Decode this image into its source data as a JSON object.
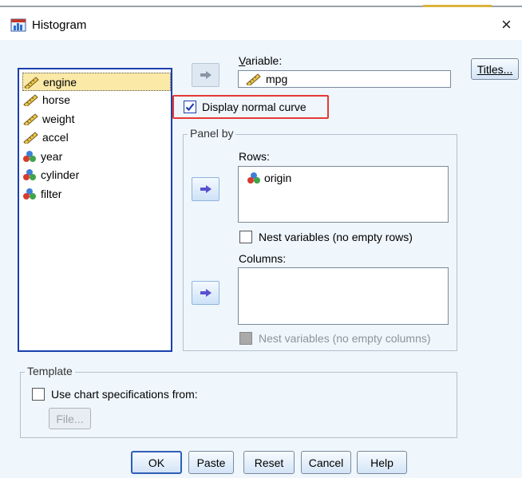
{
  "window": {
    "title": "Histogram",
    "close_glyph": "×"
  },
  "variables": {
    "items": [
      {
        "label": "engine",
        "icon": "ruler-scale-icon",
        "selected": true
      },
      {
        "label": "horse",
        "icon": "ruler-scale-icon",
        "selected": false
      },
      {
        "label": "weight",
        "icon": "ruler-scale-icon",
        "selected": false
      },
      {
        "label": "accel",
        "icon": "ruler-scale-icon",
        "selected": false
      },
      {
        "label": "year",
        "icon": "nominal-balls-icon",
        "selected": false
      },
      {
        "label": "cylinder",
        "icon": "nominal-balls-icon",
        "selected": false
      },
      {
        "label": "filter",
        "icon": "nominal-balls-icon",
        "selected": false
      }
    ]
  },
  "variable_field": {
    "label": "Variable:",
    "value": "mpg",
    "icon": "ruler-scale-icon"
  },
  "normal_curve": {
    "label": "Display normal curve",
    "checked": true
  },
  "panel_by": {
    "title": "Panel by",
    "rows": {
      "label": "Rows:",
      "values": [
        "origin"
      ],
      "icon": "nominal-balls-icon"
    },
    "nest_rows": {
      "label": "Nest variables (no empty rows)",
      "checked": false
    },
    "columns": {
      "label": "Columns:",
      "values": []
    },
    "nest_columns": {
      "label": "Nest variables (no empty columns)",
      "checked": false,
      "enabled": false
    }
  },
  "titles_button": "Titles...",
  "template": {
    "title": "Template",
    "use_spec": {
      "label": "Use chart specifications from:",
      "checked": false
    },
    "file_button": "File..."
  },
  "buttons": {
    "ok": "OK",
    "paste": "Paste",
    "reset": "Reset",
    "cancel": "Cancel",
    "help": "Help"
  },
  "colors": {
    "accent": "#1b3fae",
    "highlight": "#e53935",
    "selection": "#fbe9a8",
    "client_bg": "#eff6fc"
  }
}
